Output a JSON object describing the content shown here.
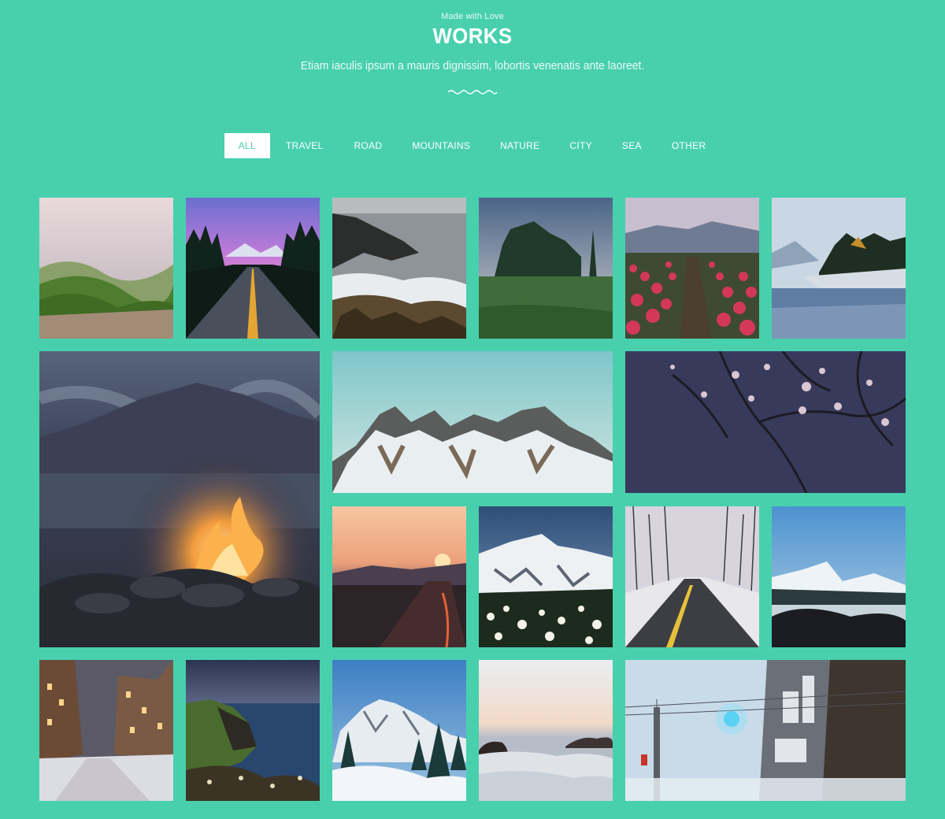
{
  "header": {
    "eyebrow": "Made with Love",
    "title": "WORKS",
    "subtitle": "Etiam iaculis ipsum a mauris dignissim, lobortis venenatis ante laoreet."
  },
  "filters": [
    {
      "label": "ALL",
      "active": true
    },
    {
      "label": "TRAVEL",
      "active": false
    },
    {
      "label": "ROAD",
      "active": false
    },
    {
      "label": "MOUNTAINS",
      "active": false
    },
    {
      "label": "NATURE",
      "active": false
    },
    {
      "label": "CITY",
      "active": false
    },
    {
      "label": "SEA",
      "active": false
    },
    {
      "label": "OTHER",
      "active": false
    }
  ],
  "colors": {
    "background": "#48d0ad",
    "active_filter_text": "#48d0ad",
    "active_filter_bg": "#ffffff"
  },
  "gallery": [
    {
      "id": "misty-hills",
      "scene": "hills"
    },
    {
      "id": "purple-sky-road",
      "scene": "road-dusk"
    },
    {
      "id": "rocky-shore",
      "scene": "shore"
    },
    {
      "id": "tree-meadow",
      "scene": "trees"
    },
    {
      "id": "tulip-field",
      "scene": "tulips"
    },
    {
      "id": "lake-island",
      "scene": "lake"
    },
    {
      "id": "campfire",
      "scene": "fire"
    },
    {
      "id": "snowy-ridge",
      "scene": "ridge"
    },
    {
      "id": "night-blossoms",
      "scene": "blossoms"
    },
    {
      "id": "sunset-road",
      "scene": "sunset"
    },
    {
      "id": "snow-peak-flowers",
      "scene": "peak"
    },
    {
      "id": "winter-road",
      "scene": "winter-road"
    },
    {
      "id": "car-window-mountain",
      "scene": "car"
    },
    {
      "id": "snowy-city-street",
      "scene": "city-snow"
    },
    {
      "id": "sea-cliffs",
      "scene": "cliffs"
    },
    {
      "id": "snowy-pines",
      "scene": "pines"
    },
    {
      "id": "beach-waves",
      "scene": "beach"
    },
    {
      "id": "rainy-street",
      "scene": "rain-street"
    }
  ]
}
